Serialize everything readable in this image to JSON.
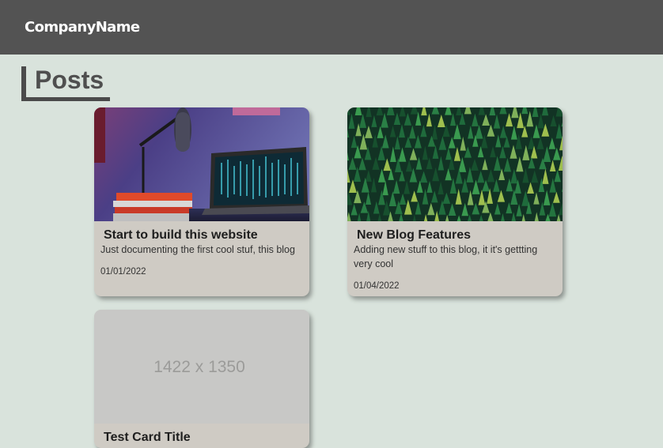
{
  "navbar": {
    "brand": "CompanyName"
  },
  "page": {
    "heading": "Posts"
  },
  "cards": [
    {
      "image_desc": "desk-with-microphone-and-laptop-photo",
      "title": "Start to build this website",
      "text": "Just documenting the first cool stuf, this blog",
      "date": "01/01/2022"
    },
    {
      "image_desc": "pine-forest-aerial-photo",
      "title": "New Blog Features",
      "text": "Adding new stuff to this blog, it it's gettting very cool",
      "date": "01/04/2022"
    },
    {
      "image_label": "1422 x 1350",
      "title": "Test Card Title"
    }
  ],
  "colors": {
    "background": "#d9e3dc",
    "navbar": "#535353",
    "card": "#cfcbc4",
    "heading": "#4f4f4f"
  }
}
